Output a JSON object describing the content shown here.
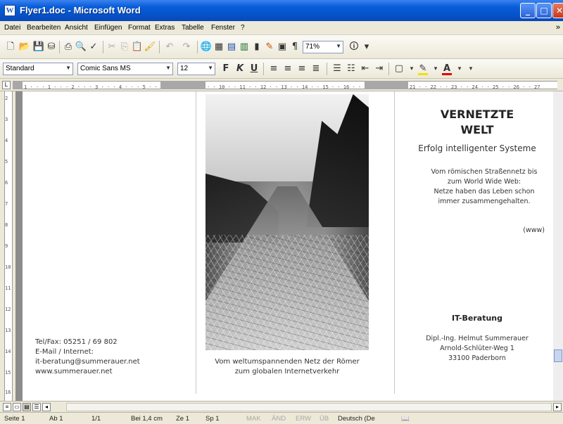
{
  "window": {
    "title": "Flyer1.doc - Microsoft Word",
    "app_icon": "W",
    "buttons": {
      "minimize": "_",
      "maximize": "□",
      "close": "✕"
    }
  },
  "menu": [
    "Datei",
    "Bearbeiten",
    "Ansicht",
    "Einfügen",
    "Format",
    "Extras",
    "Tabelle",
    "Fenster",
    "?"
  ],
  "menu_more": "»",
  "toolbar_standard": {
    "zoom": "71%"
  },
  "toolbar_format": {
    "style": "Standard",
    "font": "Comic Sans MS",
    "size": "12",
    "bold": "F",
    "italic": "K",
    "underline": "U",
    "highlight_color": "#f0e000",
    "font_color": "#e00000"
  },
  "ruler": {
    "ticks_left": "1 · · · 1 · · · 2 · · · 3 · · · 4 · · · 5 · · · 6 · ·",
    "ticks_mid": "· · 10 · · 11 · · 12 · · 13 · · 14 · · 15 · · 16 · · 17 ·",
    "ticks_right": "21 · · 22 · · 23 · · 24 · · 25 · · 26 · · 27"
  },
  "document": {
    "left_column": {
      "phone": "Tel/Fax: 05251 / 69 802",
      "email_label": "E-Mail / Internet:",
      "email": "it-beratung@summerauer.net",
      "web": "www.summerauer.net"
    },
    "middle_column": {
      "caption_line1": "Vom weltumspannenden Netz der Römer",
      "caption_line2": "zum globalen Internetverkehr"
    },
    "right_column": {
      "headline_line1": "VERNETZTE",
      "headline_line2": "WELT",
      "subhead": "Erfolg intelligenter Systeme",
      "intro_line1": "Vom römischen Straßennetz bis",
      "intro_line2": "zum World Wide Web:",
      "intro_line3": "Netze haben das Leben schon",
      "intro_line4": "immer zusammengehalten.",
      "www": "(www)",
      "section_title": "IT-Beratung",
      "name": "Dipl.-Ing. Helmut Summerauer",
      "street": "Arnold-Schlüter-Weg 1",
      "city": "33100 Paderborn"
    }
  },
  "status": {
    "page": "Seite 1",
    "section": "Ab 1",
    "pages": "1/1",
    "position": "Bei 1,4 cm",
    "line": "Ze 1",
    "column": "Sp 1",
    "mak": "MAK",
    "aen": "ÄND",
    "erw": "ERW",
    "ub": "ÜB",
    "language": "Deutsch (De"
  }
}
